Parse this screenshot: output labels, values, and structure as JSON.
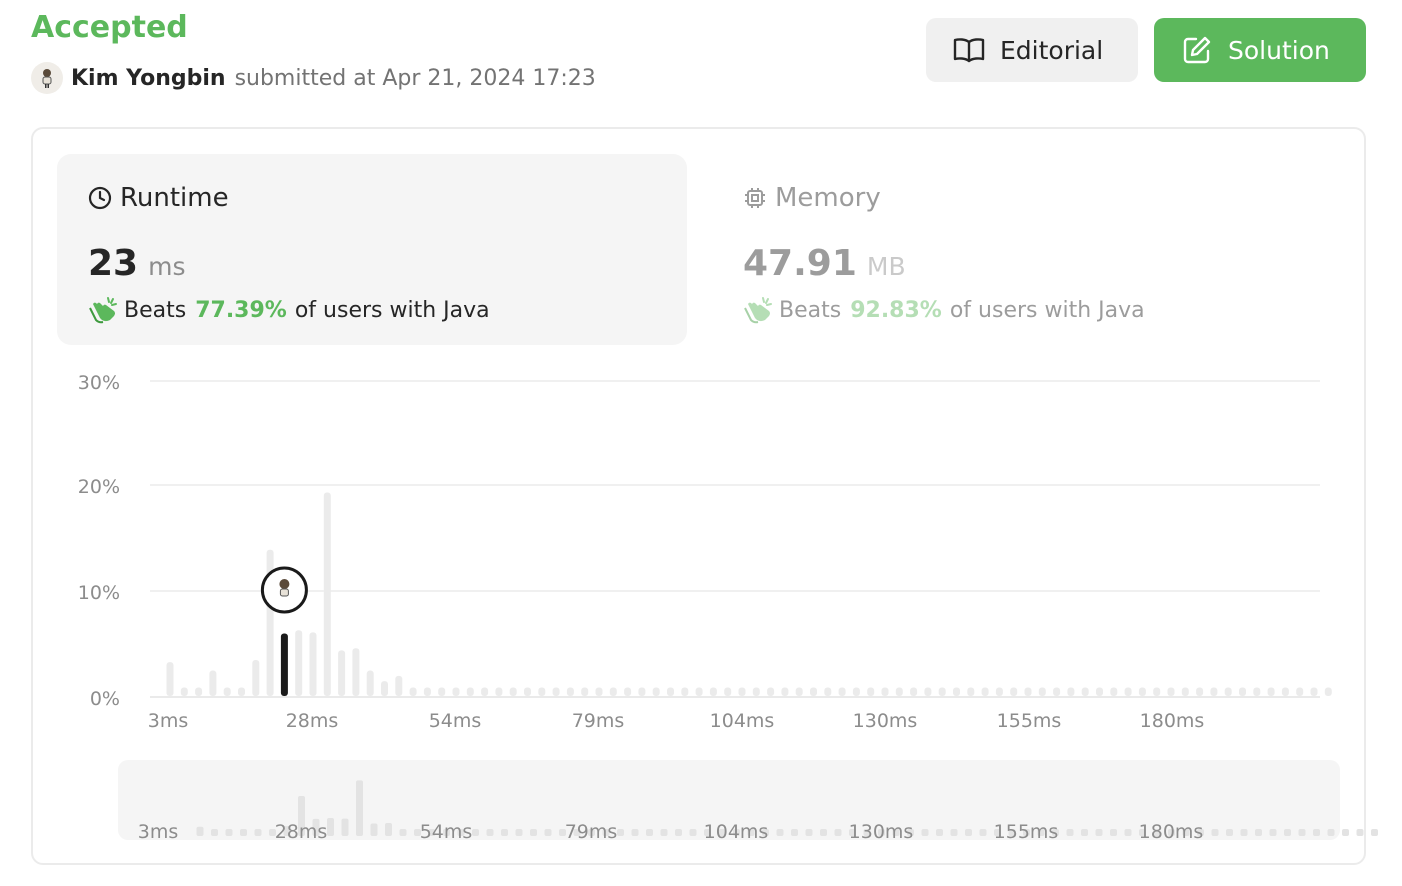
{
  "header": {
    "status": "Accepted",
    "user_name": "Kim Yongbin",
    "submitted_text": "submitted at Apr 21, 2024 17:23"
  },
  "buttons": {
    "editorial_label": "Editorial",
    "solution_label": "Solution"
  },
  "runtime": {
    "title": "Runtime",
    "value": "23",
    "unit": "ms",
    "beats_prefix": "Beats",
    "beats_pct": "77.39%",
    "beats_suffix": "of users with Java"
  },
  "memory": {
    "title": "Memory",
    "value": "47.91",
    "unit": "MB",
    "beats_prefix": "Beats",
    "beats_pct": "92.83%",
    "beats_suffix": "of users with Java"
  },
  "colors": {
    "accent_green": "#5cb85c",
    "bar_default": "#ebebeb",
    "bar_highlight": "#1a1a1a"
  },
  "chart_data": {
    "type": "bar",
    "y_tick_labels": [
      "0%",
      "10%",
      "20%",
      "30%"
    ],
    "ylim": [
      0,
      30
    ],
    "x_tick_labels": [
      "3ms",
      "28ms",
      "54ms",
      "79ms",
      "104ms",
      "130ms",
      "155ms",
      "180ms"
    ],
    "highlight_index": 8,
    "values": [
      3.2,
      0.8,
      0.8,
      2.4,
      0.8,
      0.8,
      3.4,
      13.8,
      5.9,
      6.2,
      6.0,
      19.2,
      4.3,
      4.5,
      2.4,
      1.4,
      1.9,
      0.8,
      0.8,
      0.8,
      0.8,
      0.8,
      0.8,
      0.8,
      0.8,
      0.8,
      0.8,
      0.8,
      0.8,
      0.8,
      0.8,
      0.8,
      0.8,
      0.8,
      0.8,
      0.8,
      0.8,
      0.8,
      0.8,
      0.8,
      0.8,
      0.8,
      0.8,
      0.8,
      0.8,
      0.8,
      0.8,
      0.8,
      0.8,
      0.8,
      0.8,
      0.8,
      0.8,
      0.8,
      0.8,
      0.8,
      0.8,
      0.8,
      0.8,
      0.8,
      0.8,
      0.8,
      0.8,
      0.8,
      0.8,
      0.8,
      0.8,
      0.8,
      0.8,
      0.8,
      0.8,
      0.8,
      0.8,
      0.8,
      0.8,
      0.8,
      0.8,
      0.8,
      0.8,
      0.8,
      0.8,
      0.8
    ]
  }
}
